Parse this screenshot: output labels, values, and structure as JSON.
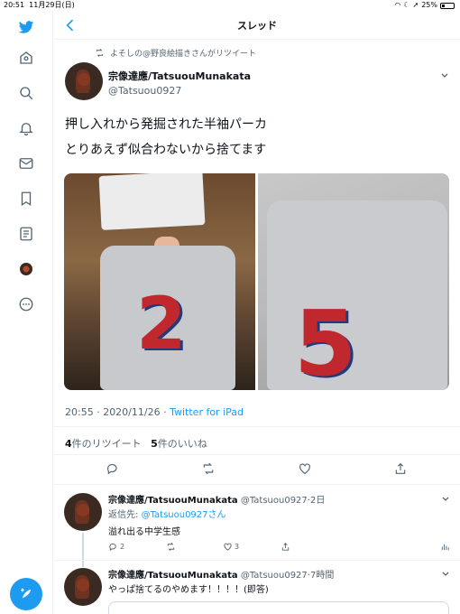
{
  "status_bar": {
    "time": "20:51",
    "date": "11月29日(日)",
    "battery": "25%"
  },
  "header": {
    "title": "スレッド"
  },
  "retweet_notice": "よそしの@野良絵描きさんがリツイート",
  "main_tweet": {
    "name": "宗像達應/TatsuouMunakata",
    "handle": "@Tatsuou0927",
    "line1": "押し入れから発掘された半袖パーカ",
    "line2": "とりあえず似合わないから捨てます",
    "timestamp": "20:55 · 2020/11/26 · ",
    "source": "Twitter for iPad",
    "retweet_count": "4",
    "retweet_label": "件のリツイート",
    "like_count": "5",
    "like_label": "件のいいね"
  },
  "reply1": {
    "name": "宗像達應/TatsuouMunakata",
    "handle_time": "@Tatsuou0927·2日",
    "reply_to_label": "返信先: ",
    "reply_to_handle": "@Tatsuou0927さん",
    "text": "溢れ出る中学生感",
    "reply_count": "2",
    "like_count": "3"
  },
  "reply2": {
    "name": "宗像達應/TatsuouMunakata",
    "handle_time": "@Tatsuou0927·7時間",
    "text": "やっぱ捨てるのやめます！！！！(即答)"
  },
  "colors": {
    "accent": "#1d9bf0",
    "muted": "#536471",
    "divider": "#eff3f4"
  },
  "icons": {
    "sidebar": [
      "twitter-bird-icon",
      "home-icon",
      "search-icon",
      "bell-icon",
      "mail-icon",
      "bookmark-icon",
      "list-icon",
      "profile-avatar",
      "more-icon"
    ],
    "actions": [
      "reply-icon",
      "retweet-icon",
      "like-icon",
      "share-icon"
    ]
  }
}
